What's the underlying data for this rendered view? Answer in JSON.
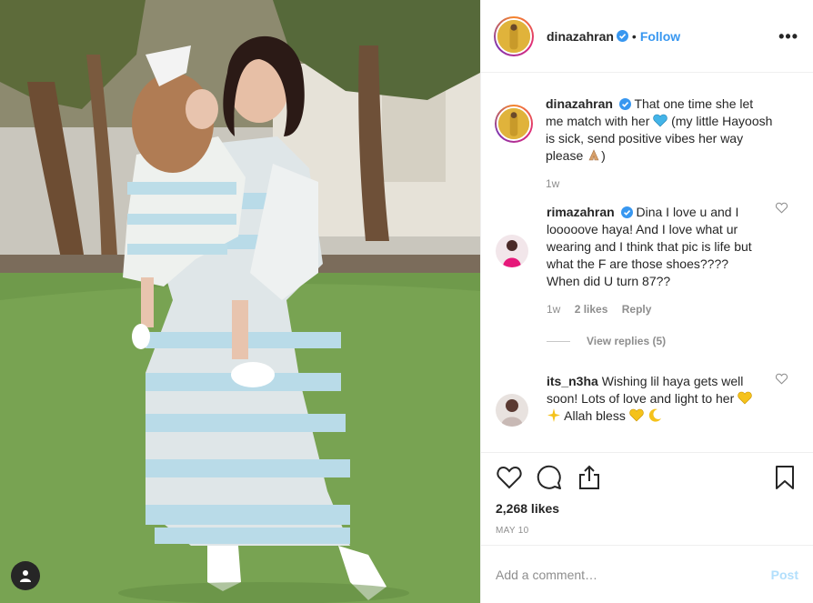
{
  "post": {
    "author": "dinazahran",
    "follow_label": "Follow",
    "dot": "•",
    "more_label": "•••",
    "caption": {
      "username": "dinazahran",
      "text_1": "That one time she let me match with her",
      "text_2": "(my little Hayoosh is sick, send positive vibes her way please",
      "text_3": ")",
      "time": "1w"
    },
    "comments": [
      {
        "username": "rimazahran",
        "text": "Dina I love u and I looooove haya! And I love what ur wearing and I think that pic is life but what the F are those shoes???? When did U turn 87??",
        "time": "1w",
        "likes": "2 likes",
        "reply": "Reply",
        "view_replies": "View replies (5)"
      },
      {
        "username": "its_n3ha",
        "text_1": "Wishing lil haya gets well soon! Lots of love and light to her",
        "text_2": "Allah bless"
      }
    ],
    "likes": "2,268 likes",
    "date": "MAY 10",
    "add_comment_placeholder": "Add a comment…",
    "post_label": "Post"
  },
  "icons": {
    "verified": "verified-badge-icon",
    "heart": "heart-icon",
    "comment": "comment-icon",
    "share": "share-icon",
    "bookmark": "bookmark-icon",
    "user_tag": "user-tag-icon",
    "emojis": [
      "blue-heart-emoji",
      "folded-hands-emoji",
      "yellow-heart-emoji",
      "sparkles-emoji",
      "crescent-moon-emoji"
    ]
  },
  "colors": {
    "accent": "#3897f0",
    "post_disabled": "#b2dffc",
    "muted": "#8e8e8e"
  }
}
